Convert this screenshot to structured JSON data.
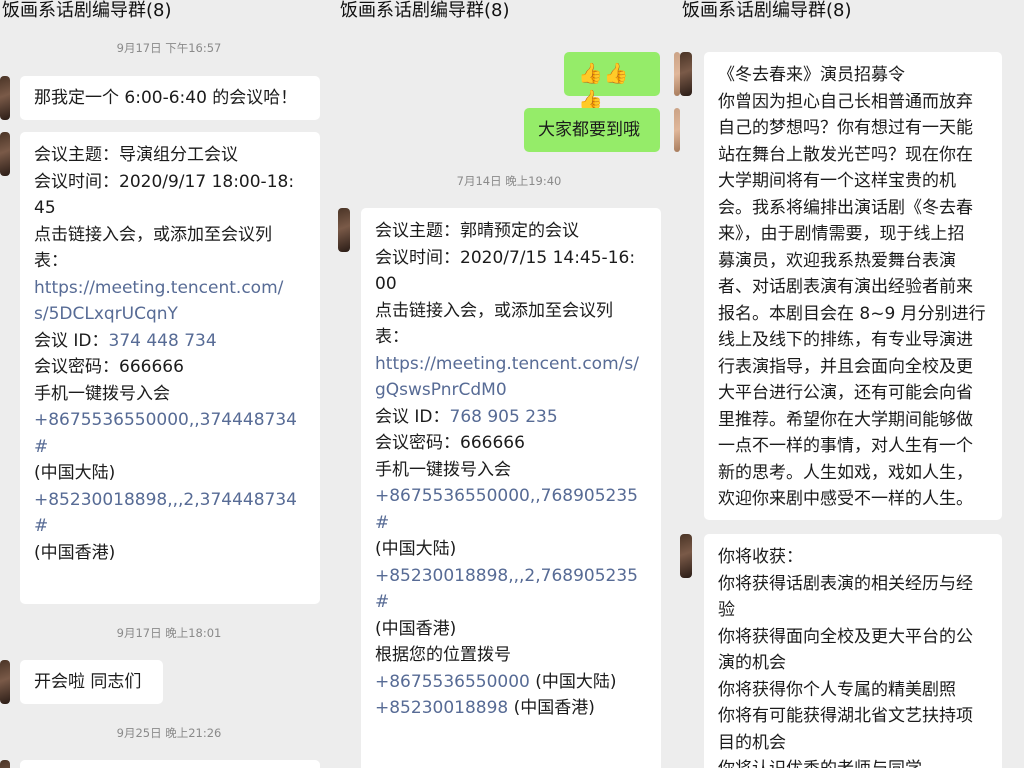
{
  "panel1": {
    "title": "饭画系话剧编导群(8)",
    "ts1": "9月17日 下午16:57",
    "msg1": "那我定一个 6:00-6:40 的会议哈！",
    "meeting": {
      "subject": "会议主题：导演组分工会议",
      "time_a": "会议时间：2020/9/17 18:00-18:",
      "time_b": "45",
      "click_a": "点击链接入会，或添加至会议列",
      "click_b": "表：",
      "url_a": "https://meeting.tencent.com/",
      "url_b": "s/5DCLxqrUCqnY",
      "id_label": "会议 ID：",
      "id_value": "374 448 734",
      "pwd": "会议密码：666666",
      "dial_title": "手机一键拨号入会",
      "dial1": "+8675536550000,,374448734#",
      "dial1_region": "(中国大陆)",
      "dial2": "+85230018898,,,2,374448734#",
      "dial2_region": "(中国香港)"
    },
    "ts2": "9月17日 晚上18:01",
    "msg2": "开会啦 同志们",
    "ts3": "9月25日 晚上21:26"
  },
  "panel2": {
    "title": "饭画系话剧编导群(8)",
    "thumbs": "👍👍👍",
    "msg_green": "大家都要到哦",
    "ts1": "7月14日 晚上19:40",
    "meeting": {
      "subject": "会议主题：郭晴预定的会议",
      "time_a": "会议时间：2020/7/15 14:45-16:",
      "time_b": "00",
      "click_a": "点击链接入会，或添加至会议列",
      "click_b": "表：",
      "url_a": "https://meeting.tencent.com/s/",
      "url_b": "gQswsPnrCdM0",
      "id_label": "会议 ID：",
      "id_value": "768 905 235",
      "pwd": "会议密码：666666",
      "dial_title": "手机一键拨号入会",
      "dial1": "+8675536550000,,768905235#",
      "dial1_region": "(中国大陆)",
      "dial2": "+85230018898,,,2,768905235#",
      "dial2_region": "(中国香港)",
      "loc_title": "根据您的位置拨号",
      "loc1": "+8675536550000",
      "loc1_region": " (中国大陆)",
      "loc2": "+85230018898",
      "loc2_region": " (中国香港)"
    }
  },
  "panel3": {
    "title": "饭画系话剧编导群(8)",
    "recruit_lines": [
      "《冬去春来》演员招募令",
      "你曾因为担心自己长相普通而放弃",
      "自己的梦想吗？你有想过有一天能",
      "站在舞台上散发光芒吗？现在你在",
      "大学期间将有一个这样宝贵的机",
      "会。我系将编排出演话剧《冬去春",
      "来》，由于剧情需要，现于线上招",
      "募演员，欢迎我系热爱舞台表演",
      "者、对话剧表演有演出经验者前来",
      "报名。本剧目会在 8~9 月分别进行",
      "线上及线下的排练，有专业导演进",
      "行表演指导，并且会面向全校及更",
      "大平台进行公演，还有可能会向省",
      "里推荐。希望你在大学期间能够做",
      "一点不一样的事情，对人生有一个",
      "新的思考。人生如戏，戏如人生，",
      "欢迎你来剧中感受不一样的人生。"
    ],
    "gain_lines": [
      "你将收获：",
      "你将获得话剧表演的相关经历与经",
      "验",
      "你将获得面向全校及更大平台的公",
      "演的机会",
      "你将获得你个人专属的精美剧照",
      "你将有可能获得湖北省文艺扶持项",
      "目的机会",
      "你将认识优秀的老师与同学"
    ]
  }
}
